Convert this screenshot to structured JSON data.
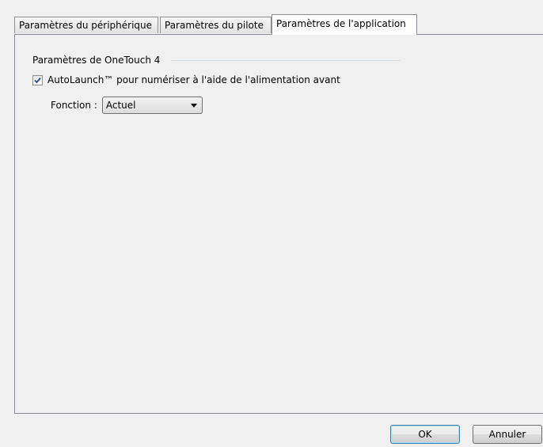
{
  "tabs": [
    {
      "label": "Paramètres du périphérique"
    },
    {
      "label": "Paramètres du pilote"
    },
    {
      "label": "Paramètres de l'application",
      "active": true
    }
  ],
  "group": {
    "title": "Paramètres de OneTouch 4"
  },
  "autolaunch": {
    "label": "AutoLaunch™ pour numériser à l'aide de l'alimentation avant",
    "checked": true
  },
  "function": {
    "label": "Fonction :",
    "value": "Actuel"
  },
  "buttons": {
    "ok": "OK",
    "cancel": "Annuler"
  }
}
